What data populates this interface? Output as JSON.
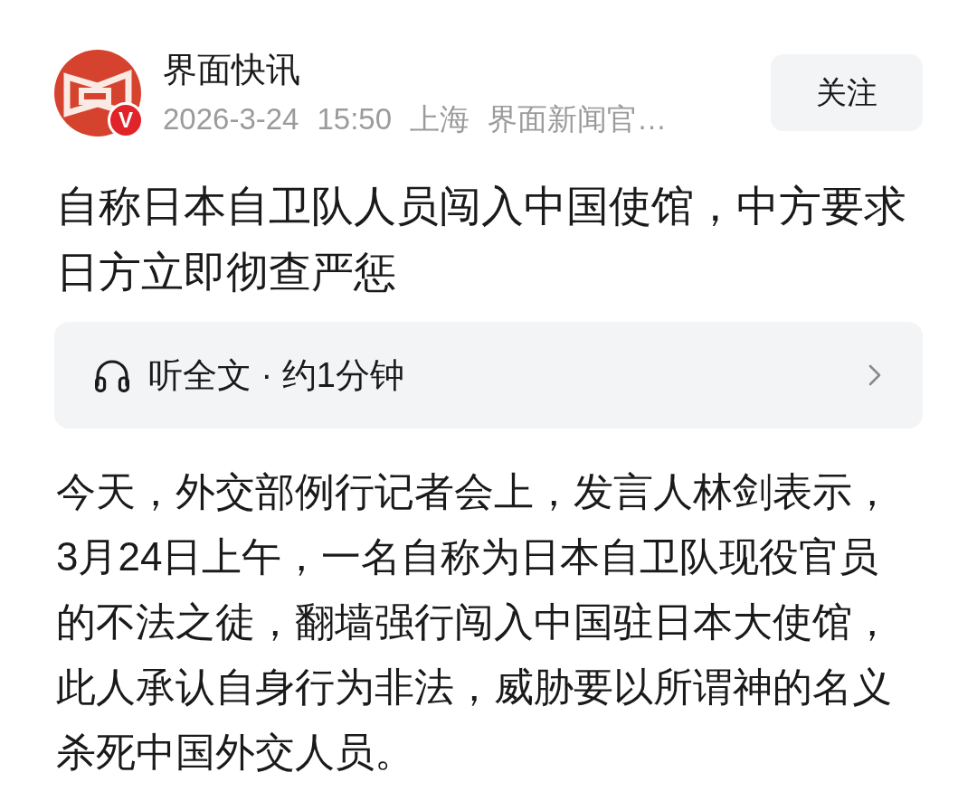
{
  "account": {
    "name": "界面快讯",
    "badge": "V",
    "date": "2026-3-24",
    "time": "15:50",
    "location": "上海",
    "source": "界面新闻官…"
  },
  "follow_button": "关注",
  "article": {
    "title": "自称日本自卫队人员闯入中国使馆，中方要求日方立即彻查严惩",
    "listen": "听全文 · 约1分钟",
    "body": "今天，外交部例行记者会上，发言人林剑表示，3月24日上午，一名自称为日本自卫队现役官员的不法之徒，翻墙强行闯入中国驻日本大使馆，此人承认自身行为非法，威胁要以所谓神的名义杀死中国外交人员。"
  }
}
